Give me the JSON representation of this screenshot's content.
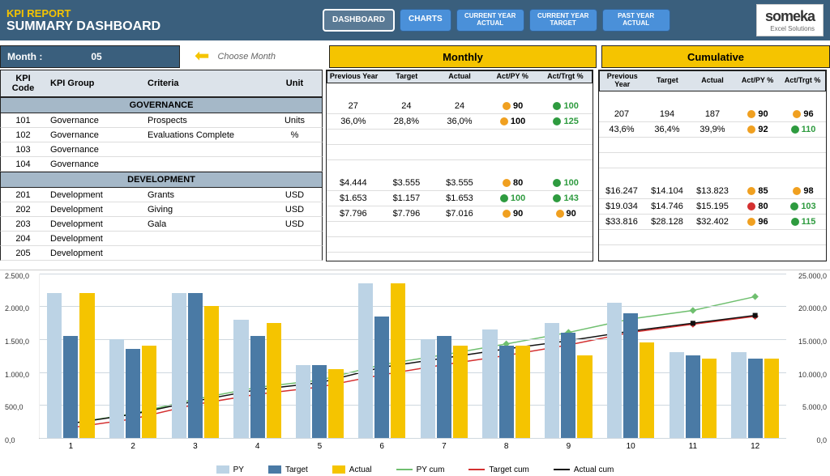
{
  "header": {
    "report_title": "KPI REPORT",
    "subtitle": "SUMMARY DASHBOARD",
    "nav": {
      "dashboard": "DASHBOARD",
      "charts": "CHARTS",
      "cy_actual": "CURRENT YEAR ACTUAL",
      "cy_target": "CURRENT YEAR TARGET",
      "py_actual": "PAST YEAR ACTUAL"
    },
    "logo_main": "someka",
    "logo_sub": "Excel Solutions"
  },
  "month_selector": {
    "label": "Month :",
    "value": "05",
    "hint": "Choose Month"
  },
  "group_titles": {
    "monthly": "Monthly",
    "cumulative": "Cumulative"
  },
  "columns": {
    "kpi_code": "KPI Code",
    "kpi_group": "KPI Group",
    "criteria": "Criteria",
    "unit": "Unit",
    "prev_year": "Previous Year",
    "target": "Target",
    "actual": "Actual",
    "act_py": "Act/PY %",
    "act_trgt": "Act/Trgt %"
  },
  "sections": [
    {
      "name": "GOVERNANCE",
      "rows": [
        {
          "code": "101",
          "group": "Governance",
          "criteria": "Prospects",
          "unit": "Units",
          "m": {
            "py": "27",
            "tgt": "24",
            "act": "24",
            "apy": "90",
            "apy_c": "orange",
            "atr": "100",
            "atr_c": "green"
          },
          "c": {
            "py": "207",
            "tgt": "194",
            "act": "187",
            "apy": "90",
            "apy_c": "orange",
            "atr": "96",
            "atr_c": "orange"
          }
        },
        {
          "code": "102",
          "group": "Governance",
          "criteria": "Evaluations Complete",
          "unit": "%",
          "m": {
            "py": "36,0%",
            "tgt": "28,8%",
            "act": "36,0%",
            "apy": "100",
            "apy_c": "orange",
            "atr": "125",
            "atr_c": "green"
          },
          "c": {
            "py": "43,6%",
            "tgt": "36,4%",
            "act": "39,9%",
            "apy": "92",
            "apy_c": "orange",
            "atr": "110",
            "atr_c": "green"
          }
        },
        {
          "code": "103",
          "group": "Governance"
        },
        {
          "code": "104",
          "group": "Governance"
        }
      ]
    },
    {
      "name": "DEVELOPMENT",
      "rows": [
        {
          "code": "201",
          "group": "Development",
          "criteria": "Grants",
          "unit": "USD",
          "m": {
            "py": "$4.444",
            "tgt": "$3.555",
            "act": "$3.555",
            "apy": "80",
            "apy_c": "orange",
            "atr": "100",
            "atr_c": "green"
          },
          "c": {
            "py": "$16.247",
            "tgt": "$14.104",
            "act": "$13.823",
            "apy": "85",
            "apy_c": "orange",
            "atr": "98",
            "atr_c": "orange"
          }
        },
        {
          "code": "202",
          "group": "Development",
          "criteria": "Giving",
          "unit": "USD",
          "m": {
            "py": "$1.653",
            "tgt": "$1.157",
            "act": "$1.653",
            "apy": "100",
            "apy_c": "green",
            "atr": "143",
            "atr_c": "green"
          },
          "c": {
            "py": "$19.034",
            "tgt": "$14.746",
            "act": "$15.195",
            "apy": "80",
            "apy_c": "red",
            "atr": "103",
            "atr_c": "green"
          }
        },
        {
          "code": "203",
          "group": "Development",
          "criteria": "Gala",
          "unit": "USD",
          "m": {
            "py": "$7.796",
            "tgt": "$7.796",
            "act": "$7.016",
            "apy": "90",
            "apy_c": "orange",
            "atr": "90",
            "atr_c": "orange"
          },
          "c": {
            "py": "$33.816",
            "tgt": "$28.128",
            "act": "$32.402",
            "apy": "96",
            "apy_c": "orange",
            "atr": "115",
            "atr_c": "green"
          }
        },
        {
          "code": "204",
          "group": "Development"
        },
        {
          "code": "205",
          "group": "Development"
        }
      ]
    }
  ],
  "chart_data": {
    "type": "bar+line",
    "categories": [
      "1",
      "2",
      "3",
      "4",
      "5",
      "6",
      "7",
      "8",
      "9",
      "10",
      "11",
      "12"
    ],
    "y1_ticks": [
      "0,0",
      "500,0",
      "1.000,0",
      "1.500,0",
      "2.000,0",
      "2.500,0"
    ],
    "y1_lim": [
      0,
      2500
    ],
    "y2_ticks": [
      "0,0",
      "5.000,0",
      "10.000,0",
      "15.000,0",
      "20.000,0",
      "25.000,0"
    ],
    "y2_lim": [
      0,
      25000
    ],
    "series_bars": [
      {
        "name": "PY",
        "color": "#bcd3e5",
        "values": [
          2200,
          1500,
          2200,
          1800,
          1100,
          2350,
          1500,
          1650,
          1750,
          2050,
          1300,
          1300
        ]
      },
      {
        "name": "Target",
        "color": "#4a7aa5",
        "values": [
          1550,
          1350,
          2200,
          1550,
          1100,
          1850,
          1550,
          1400,
          1600,
          1900,
          1250,
          1200
        ]
      },
      {
        "name": "Actual",
        "color": "#f5c400",
        "values": [
          2200,
          1400,
          2000,
          1750,
          1050,
          2350,
          1400,
          1400,
          1250,
          1450,
          1200,
          1200
        ]
      }
    ],
    "series_lines": [
      {
        "name": "PY cum",
        "color": "#6fbf6f",
        "marker": "diamond",
        "values": [
          2200,
          3700,
          5900,
          7700,
          8800,
          11150,
          12650,
          14300,
          16050,
          18100,
          19400,
          21500
        ]
      },
      {
        "name": "Target cum",
        "color": "#d43030",
        "marker": "diamond",
        "values": [
          1550,
          2900,
          5100,
          6650,
          7750,
          9600,
          11150,
          12550,
          14150,
          16050,
          17300,
          18500
        ]
      },
      {
        "name": "Actual cum",
        "color": "#111111",
        "marker": "square",
        "values": [
          2200,
          3600,
          5600,
          7350,
          8400,
          10750,
          12150,
          13550,
          14800,
          16250,
          17450,
          18650
        ]
      }
    ],
    "legend": [
      "PY",
      "Target",
      "Actual",
      "PY cum",
      "Target cum",
      "Actual cum"
    ]
  }
}
